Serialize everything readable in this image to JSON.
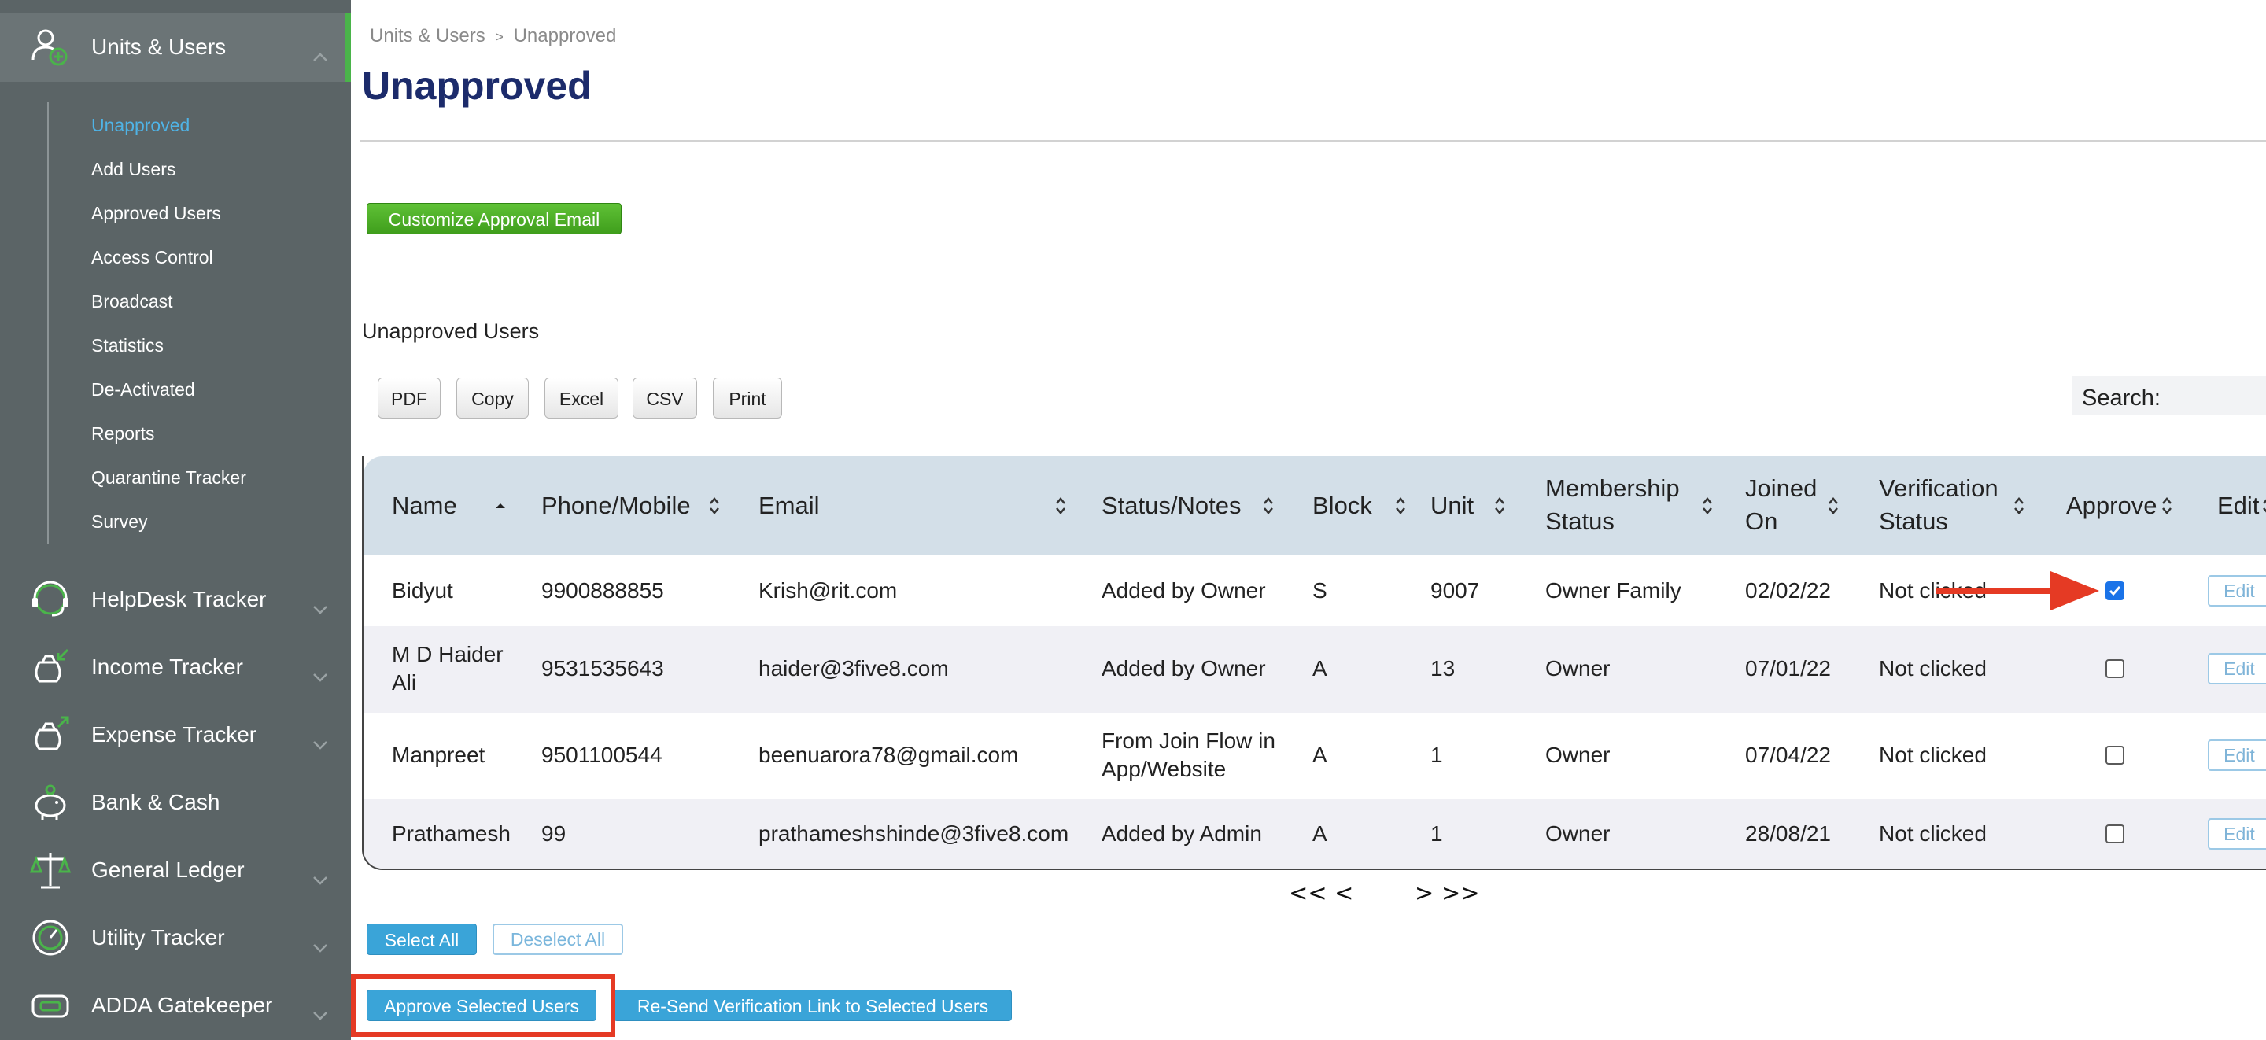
{
  "sidebar": {
    "top_item": {
      "label": "Units & Users",
      "icon": "user-add-icon"
    },
    "sub_items": [
      {
        "label": "Unapproved",
        "active": true
      },
      {
        "label": "Add Users"
      },
      {
        "label": "Approved Users"
      },
      {
        "label": "Access Control"
      },
      {
        "label": "Broadcast"
      },
      {
        "label": "Statistics"
      },
      {
        "label": "De-Activated"
      },
      {
        "label": "Reports"
      },
      {
        "label": "Quarantine Tracker"
      },
      {
        "label": "Survey"
      }
    ],
    "nav_items": [
      {
        "label": "HelpDesk Tracker",
        "icon": "headset-icon"
      },
      {
        "label": "Income Tracker",
        "icon": "money-bag-in-icon"
      },
      {
        "label": "Expense Tracker",
        "icon": "money-bag-out-icon"
      },
      {
        "label": "Bank & Cash",
        "icon": "piggy-bank-icon"
      },
      {
        "label": "General Ledger",
        "icon": "scales-icon"
      },
      {
        "label": "Utility Tracker",
        "icon": "gauge-icon"
      },
      {
        "label": "ADDA Gatekeeper",
        "icon": "id-card-icon"
      }
    ]
  },
  "breadcrumb": {
    "parent": "Units & Users",
    "separator": ">",
    "current": "Unapproved"
  },
  "page_title": "Unapproved",
  "customize_button": "Customize Approval Email",
  "section_title": "Unapproved Users",
  "toolbar": [
    "PDF",
    "Copy",
    "Excel",
    "CSV",
    "Print"
  ],
  "search": {
    "label": "Search:",
    "value": ""
  },
  "table": {
    "headers": [
      "Name",
      "Phone/Mobile",
      "Email",
      "Status/Notes",
      "Block",
      "Unit",
      "Membership Status",
      "Joined On",
      "Verification Status",
      "Approve",
      "Edit"
    ],
    "rows": [
      {
        "name": "Bidyut",
        "phone": "9900888855",
        "email": "Krish@rit.com",
        "status": "Added by Owner",
        "block": "S",
        "unit": "9007",
        "membership": "Owner Family",
        "joined": "02/02/22",
        "verification": "Not clicked",
        "approve_checked": true,
        "edit": "Edit"
      },
      {
        "name_line1": "M D Haider",
        "name_line2": "Ali",
        "phone": "9531535643",
        "email": "haider@3five8.com",
        "status": "Added by Owner",
        "block": "A",
        "unit": "13",
        "membership": "Owner",
        "joined": "07/01/22",
        "verification": "Not clicked",
        "approve_checked": false,
        "edit": "Edit"
      },
      {
        "name": "Manpreet",
        "phone": "9501100544",
        "email": "beenuarora78@gmail.com",
        "status_line1": "From Join Flow in",
        "status_line2": "App/Website",
        "block": "A",
        "unit": "1",
        "membership": "Owner",
        "joined": "07/04/22",
        "verification": "Not clicked",
        "approve_checked": false,
        "edit": "Edit"
      },
      {
        "name": "Prathamesh",
        "phone": "99",
        "email": "prathameshshinde@3five8.com",
        "status": "Added by Admin",
        "block": "A",
        "unit": "1",
        "membership": "Owner",
        "joined": "28/08/21",
        "verification": "Not clicked",
        "approve_checked": false,
        "edit": "Edit"
      }
    ]
  },
  "pager": {
    "first": "<<",
    "prev": "<",
    "next": ">",
    "last": ">>"
  },
  "select_all": "Select All",
  "deselect_all": "Deselect All",
  "approve_button": "Approve Selected Users",
  "resend_button": "Re-Send Verification Link to Selected Users",
  "colors": {
    "sidebar_bg": "#5b6466",
    "accent_green": "#4ab44a",
    "link_blue": "#4fb3e6",
    "title_navy": "#1c2b6b",
    "highlight_red": "#e53a24"
  }
}
